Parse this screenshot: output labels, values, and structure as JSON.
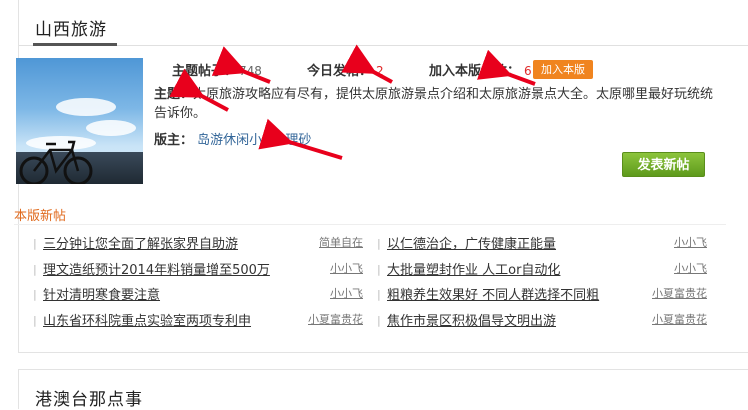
{
  "forum": {
    "title": "山西旅游",
    "stats": {
      "threads_label": "主题帖子：",
      "threads_value": "748",
      "today_label": "今日发帖：",
      "today_value": "2",
      "members_label": "加入本版人数：",
      "members_value": "6",
      "join_button": "加入本版"
    },
    "topic_label": "主题：",
    "topic_text": "太原旅游攻略应有尽有，提供太原旅游景点介绍和太原旅游景点大全。太原哪里最好玩统统告诉你。",
    "moderators_label": "版主：",
    "moderators": [
      "岛游休闲小编",
      "理砂"
    ],
    "post_button": "发表新帖",
    "new_posts_label": "本版新帖",
    "posts_left": [
      {
        "title": "三分钟让您全面了解张家界自助游",
        "author": "简单自在"
      },
      {
        "title": "理文造纸预计2014年料销量增至500万",
        "author": "小小飞"
      },
      {
        "title": "针对清明寒食要注意",
        "author": "小小飞"
      },
      {
        "title": "山东省环科院重点实验室两项专利申",
        "author": "小夏富贵花"
      }
    ],
    "posts_right": [
      {
        "title": "以仁德治企，广传健康正能量",
        "author": "小小飞"
      },
      {
        "title": "大批量塑封作业 人工or自动化",
        "author": "小小飞"
      },
      {
        "title": "粗粮养生效果好 不同人群选择不同粗",
        "author": "小夏富贵花"
      },
      {
        "title": "焦作市景区积极倡导文明出游",
        "author": "小夏富贵花"
      }
    ]
  },
  "next_forum": {
    "title": "港澳台那点事"
  },
  "colors": {
    "accent_orange": "#e06a1d",
    "join_button": "#f0841f",
    "post_button": "#6fad27",
    "annotation_arrow": "#e8001c"
  }
}
